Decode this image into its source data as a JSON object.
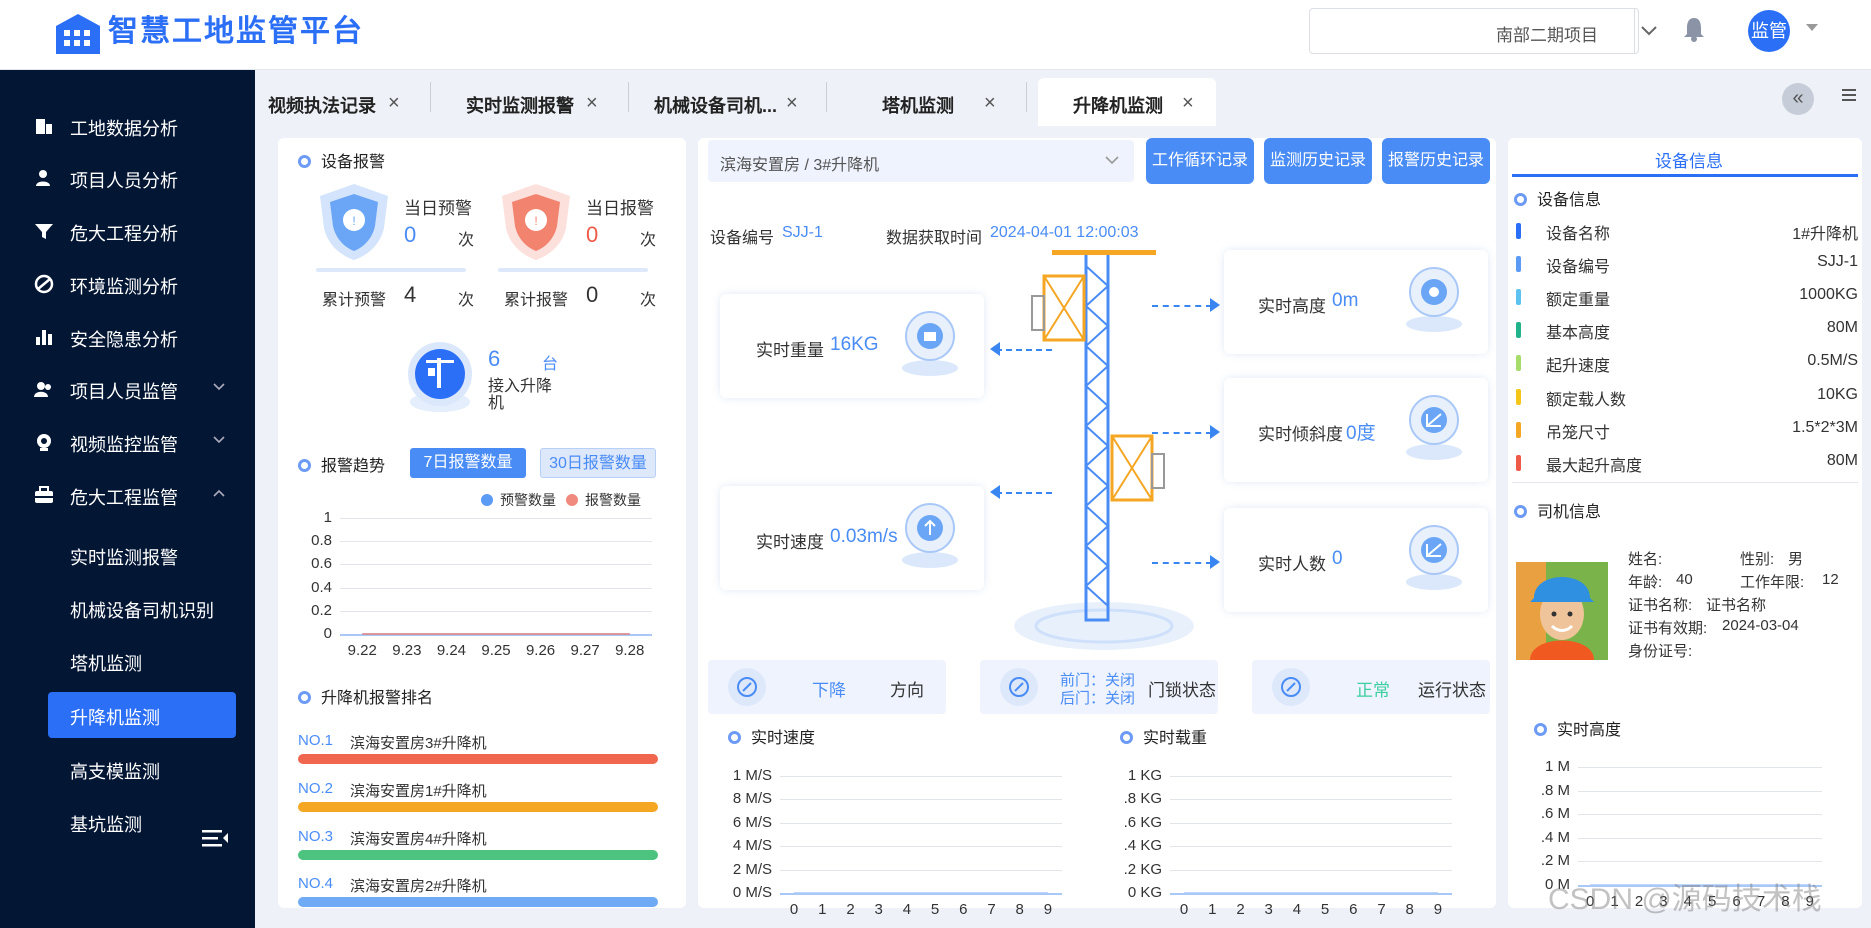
{
  "app": {
    "title": "智慧工地监管平台",
    "user_avatar_label": "监管"
  },
  "header": {
    "project_name": "南部二期项目"
  },
  "sidebar": {
    "items": [
      {
        "label": "工地数据分析",
        "icon": "building-icon"
      },
      {
        "label": "项目人员分析",
        "icon": "person-icon"
      },
      {
        "label": "危大工程分析",
        "icon": "funnel-icon"
      },
      {
        "label": "环境监测分析",
        "icon": "leaf-icon"
      },
      {
        "label": "安全隐患分析",
        "icon": "bar-chart-icon"
      },
      {
        "label": "项目人员监管",
        "icon": "group-icon"
      },
      {
        "label": "视频监控监管",
        "icon": "camera-icon"
      },
      {
        "label": "危大工程监管",
        "icon": "toolbox-icon"
      }
    ],
    "sub_items": [
      "实时监测报警",
      "机械设备司机识别",
      "塔机监测",
      "升降机监测",
      "高支模监测",
      "基坑监测"
    ],
    "active_sub": "升降机监测"
  },
  "tabs": [
    {
      "label": "视频执法记录"
    },
    {
      "label": "实时监测报警"
    },
    {
      "label": "机械设备司机..."
    },
    {
      "label": "塔机监测"
    },
    {
      "label": "升降机监测"
    }
  ],
  "alarm": {
    "title": "设备报警",
    "today_warning_label": "当日预警",
    "today_warning_value": "0",
    "unit": "次",
    "today_alarm_label": "当日报警",
    "today_alarm_value": "0",
    "total_warning_label": "累计预警",
    "total_warning_value": "4",
    "total_alarm_label": "累计报警",
    "total_alarm_value": "0",
    "access_count": "6",
    "access_unit": "台",
    "access_label": "接入升降机"
  },
  "trend": {
    "title": "报警趋势",
    "btn_7": "7日报警数量",
    "btn_30": "30日报警数量",
    "legend_warning": "预警数量",
    "legend_alarm": "报警数量",
    "colors": {
      "warning": "#5b9af5",
      "alarm": "#f08a7e"
    }
  },
  "ranking": {
    "title": "升降机报警排名",
    "items": [
      {
        "no": "NO.1",
        "name": "滨海安置房3#升降机",
        "color": "#f0664f"
      },
      {
        "no": "NO.2",
        "name": "滨海安置房1#升降机",
        "color": "#f5a623"
      },
      {
        "no": "NO.3",
        "name": "滨海安置房4#升降机",
        "color": "#4cc37e"
      },
      {
        "no": "NO.4",
        "name": "滨海安置房2#升降机",
        "color": "#6faaf5"
      }
    ]
  },
  "center": {
    "device_path": "滨海安置房 / 3#升降机",
    "btn_cycle": "工作循环记录",
    "btn_monitor": "监测历史记录",
    "btn_alarm": "报警历史记录",
    "device_code_label": "设备编号",
    "device_code": "SJJ-1",
    "fetch_time_label": "数据获取时间",
    "fetch_time": "2024-04-01 12:00:03",
    "weight_label": "实时重量",
    "weight_value": "16KG",
    "speed_label": "实时速度",
    "speed_value": "0.03m/s",
    "height_label": "实时高度",
    "height_value": "0m",
    "tilt_label": "实时倾斜度",
    "tilt_value": "0度",
    "people_label": "实时人数",
    "people_value": "0",
    "direction_value": "下降",
    "direction_label": "方向",
    "front_door": "前门：关闭",
    "back_door": "后门：关闭",
    "door_label": "门锁状态",
    "run_value": "正常",
    "run_label": "运行状态",
    "chart_speed_title": "实时速度",
    "chart_load_title": "实时载重",
    "chart_height_title": "实时高度"
  },
  "device_info": {
    "tab": "设备信息",
    "title": "设备信息",
    "rows": [
      {
        "k": "设备名称",
        "v": "1#升降机",
        "color": "#2b6ff6"
      },
      {
        "k": "设备编号",
        "v": "SJJ-1",
        "color": "#5b9af5"
      },
      {
        "k": "额定重量",
        "v": "1000KG",
        "color": "#5cc3f0"
      },
      {
        "k": "基本高度",
        "v": "80M",
        "color": "#21b38a"
      },
      {
        "k": "起升速度",
        "v": "0.5M/S",
        "color": "#a6dd6a"
      },
      {
        "k": "额定载人数",
        "v": "10KG",
        "color": "#f5c518"
      },
      {
        "k": "吊笼尺寸",
        "v": "1.5*2*3M",
        "color": "#f5a623"
      },
      {
        "k": "最大起升高度",
        "v": "80M",
        "color": "#ef5a48"
      }
    ]
  },
  "driver": {
    "title": "司机信息",
    "name_label": "姓名:",
    "gender_label": "性别:",
    "gender": "男",
    "age_label": "年龄:",
    "age": "40",
    "years_label": "工作年限:",
    "years": "12",
    "cert_name_label": "证书名称:",
    "cert_name": "证书名称",
    "cert_valid_label": "证书有效期:",
    "cert_valid": "2024-03-04",
    "id_label": "身份证号:"
  },
  "watermark": "CSDN @源码技术栈",
  "chart_data": [
    {
      "type": "line",
      "title": "报警趋势",
      "categories": [
        "9.22",
        "9.23",
        "9.24",
        "9.25",
        "9.26",
        "9.27",
        "9.28"
      ],
      "series": [
        {
          "name": "预警数量",
          "values": [
            0,
            0,
            0,
            0,
            0,
            0,
            0
          ]
        },
        {
          "name": "报警数量",
          "values": [
            0,
            0,
            0,
            0,
            0,
            0,
            0
          ]
        }
      ],
      "ylim": [
        0,
        1
      ],
      "yticks": [
        "1",
        "0.8",
        "0.6",
        "0.4",
        "0.2",
        "0"
      ]
    },
    {
      "type": "line",
      "title": "实时速度",
      "categories": [
        "0",
        "1",
        "2",
        "3",
        "4",
        "5",
        "6",
        "7",
        "8",
        "9"
      ],
      "series": [
        {
          "values": [
            0,
            0,
            0,
            0,
            0,
            0,
            0,
            0,
            0,
            0
          ]
        }
      ],
      "yticks": [
        "1 M/S",
        "8 M/S",
        "6 M/S",
        "4 M/S",
        "2 M/S",
        "0 M/S"
      ]
    },
    {
      "type": "line",
      "title": "实时载重",
      "categories": [
        "0",
        "1",
        "2",
        "3",
        "4",
        "5",
        "6",
        "7",
        "8",
        "9"
      ],
      "series": [
        {
          "values": [
            0,
            0,
            0,
            0,
            0,
            0,
            0,
            0,
            0,
            0
          ]
        }
      ],
      "yticks": [
        "1 KG",
        ".8 KG",
        ".6 KG",
        ".4 KG",
        ".2 KG",
        "0 KG"
      ]
    },
    {
      "type": "line",
      "title": "实时高度",
      "categories": [
        "0",
        "1",
        "2",
        "3",
        "4",
        "5",
        "6",
        "7",
        "8",
        "9"
      ],
      "series": [
        {
          "values": [
            0,
            0,
            0,
            0,
            0,
            0,
            0,
            0,
            0,
            0
          ]
        }
      ],
      "yticks": [
        "1 M",
        ".8 M",
        ".6 M",
        ".4 M",
        ".2 M",
        "0 M"
      ]
    }
  ]
}
